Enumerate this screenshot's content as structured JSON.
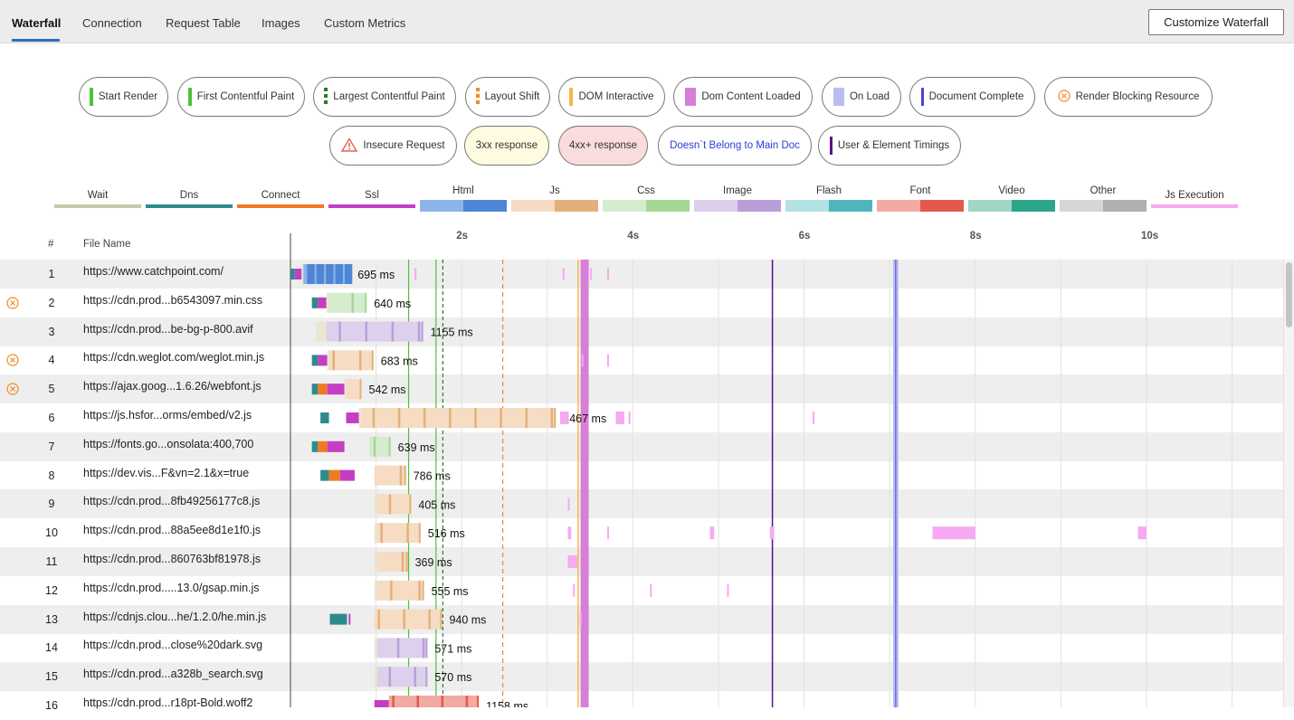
{
  "tabs": [
    {
      "label": "Waterfall",
      "active": true
    },
    {
      "label": "Connection"
    },
    {
      "label": "Request Table"
    },
    {
      "label": "Images"
    },
    {
      "label": "Custom Metrics"
    }
  ],
  "customize_button": "Customize Waterfall",
  "markers": [
    {
      "label": "Start Render",
      "color": "#4cc337",
      "style": "solid"
    },
    {
      "label": "First Contentful Paint",
      "color": "#4cc337",
      "style": "solid"
    },
    {
      "label": "Largest Contentful Paint",
      "color": "#2a7a2a",
      "style": "dashed"
    },
    {
      "label": "Layout Shift",
      "color": "#f08a24",
      "style": "dashed"
    },
    {
      "label": "DOM Interactive",
      "color": "#f2b84b",
      "style": "solid"
    },
    {
      "label": "Dom Content Loaded",
      "color": "#d77fd7",
      "style": "block"
    },
    {
      "label": "On Load",
      "color": "#b9bdf0",
      "style": "block"
    },
    {
      "label": "Document Complete",
      "color": "#4747d6",
      "style": "solid"
    },
    {
      "label": "Render Blocking Resource",
      "color": "#f08a24",
      "style": "icon"
    },
    {
      "label": "Insecure Request",
      "color": "#e0443a",
      "style": "warning"
    },
    {
      "label": "3xx response",
      "bg": "#fffbe0",
      "style": "none"
    },
    {
      "label": "4xx+ response",
      "bg": "#fbdcdc",
      "style": "none"
    },
    {
      "label": "Doesn`t Belong to Main Doc",
      "textColor": "#2a3ed6",
      "style": "none"
    },
    {
      "label": "User & Element Timings",
      "color": "#5a128a",
      "style": "solid"
    }
  ],
  "legend": [
    {
      "label": "Wait",
      "c1": "#c9c8a8"
    },
    {
      "label": "Dns",
      "c1": "#2e8b8b"
    },
    {
      "label": "Connect",
      "c1": "#f07a22"
    },
    {
      "label": "Ssl",
      "c1": "#c43ec4"
    },
    {
      "label": "Html",
      "c1": "#8db4e8",
      "c2": "#4e86d6"
    },
    {
      "label": "Js",
      "c1": "#f5dcc2",
      "c2": "#e3b07c"
    },
    {
      "label": "Css",
      "c1": "#d5ecce",
      "c2": "#a6d795"
    },
    {
      "label": "Image",
      "c1": "#ddd0ec",
      "c2": "#b99fd8"
    },
    {
      "label": "Flash",
      "c1": "#b3e2e2",
      "c2": "#4fb6bf"
    },
    {
      "label": "Font",
      "c1": "#f2aaa3",
      "c2": "#e35a4c"
    },
    {
      "label": "Video",
      "c1": "#9fd6c4",
      "c2": "#2ca58a"
    },
    {
      "label": "Other",
      "c1": "#d6d6d6",
      "c2": "#b0b0b0"
    },
    {
      "label": "Js Execution",
      "c1": "#f7a9f2"
    }
  ],
  "columns": {
    "num": "#",
    "file": "File Name"
  },
  "axis": {
    "ticks": [
      {
        "label": "2s",
        "value": 2
      },
      {
        "label": "4s",
        "value": 4
      },
      {
        "label": "6s",
        "value": 6
      },
      {
        "label": "8s",
        "value": 8
      },
      {
        "label": "10s",
        "value": 10
      }
    ]
  },
  "timing_lines": {
    "start_render": 1.38,
    "fcp": 1.7,
    "lcp": 1.78,
    "layout_shift": 2.48,
    "dom_interactive": 3.36,
    "dom_content_loaded": 3.41,
    "on_load": 7.06,
    "document_complete": 5.63
  },
  "requests": [
    {
      "num": "1",
      "url": "https://www.catchpoint.com/",
      "type": "html",
      "render_blocking": false,
      "dur": "695 ms",
      "segs": [
        [
          "dns",
          0.0,
          0.05
        ],
        [
          "ssl",
          0.05,
          0.13
        ],
        [
          "wait",
          0.13,
          0.15
        ],
        [
          "recv",
          0.15,
          0.7
        ]
      ],
      "js": [
        [
          1.45,
          1.47
        ],
        [
          3.18,
          3.2
        ],
        [
          3.5,
          3.52
        ],
        [
          3.7,
          3.72
        ]
      ]
    },
    {
      "num": "2",
      "url": "https://cdn.prod...b6543097.min.css",
      "type": "css",
      "render_blocking": true,
      "dur": "640 ms",
      "segs": [
        [
          "dns",
          0.25,
          0.32
        ],
        [
          "ssl",
          0.32,
          0.42
        ],
        [
          "wait",
          0.42,
          0.45
        ],
        [
          "recv",
          0.45,
          0.89
        ]
      ],
      "js": []
    },
    {
      "num": "3",
      "url": "https://cdn.prod...be-bg-p-800.avif",
      "type": "image",
      "render_blocking": false,
      "dur": "1155 ms",
      "segs": [
        [
          "wait",
          0.3,
          0.42
        ],
        [
          "recv",
          0.42,
          1.55
        ]
      ],
      "js": []
    },
    {
      "num": "4",
      "url": "https://cdn.weglot.com/weglot.min.js",
      "type": "js",
      "render_blocking": true,
      "dur": "683 ms",
      "segs": [
        [
          "dns",
          0.25,
          0.32
        ],
        [
          "ssl",
          0.32,
          0.43
        ],
        [
          "wait",
          0.43,
          0.45
        ],
        [
          "recv",
          0.45,
          0.97
        ]
      ],
      "js": [
        [
          3.4,
          3.42
        ],
        [
          3.7,
          3.72
        ]
      ]
    },
    {
      "num": "5",
      "url": "https://ajax.goog...1.6.26/webfont.js",
      "type": "js",
      "render_blocking": true,
      "dur": "542 ms",
      "segs": [
        [
          "dns",
          0.25,
          0.32
        ],
        [
          "connect",
          0.32,
          0.43
        ],
        [
          "ssl",
          0.43,
          0.63
        ],
        [
          "wait",
          0.63,
          0.65
        ],
        [
          "recv",
          0.65,
          0.83
        ]
      ],
      "js": []
    },
    {
      "num": "6",
      "url": "https://js.hsfor...orms/embed/v2.js",
      "type": "js",
      "render_blocking": false,
      "dur": "2467 ms",
      "segs": [
        [
          "dns",
          0.35,
          0.45
        ],
        [
          "ssl",
          0.65,
          0.8
        ],
        [
          "wait",
          0.8,
          0.82
        ],
        [
          "recv",
          0.82,
          3.1
        ]
      ],
      "js": [
        [
          3.15,
          3.25
        ],
        [
          3.8,
          3.9
        ],
        [
          3.95,
          3.97
        ],
        [
          6.1,
          6.12
        ]
      ]
    },
    {
      "num": "7",
      "url": "https://fonts.go...onsolata:400,700",
      "type": "css",
      "render_blocking": false,
      "dur": "639 ms",
      "segs": [
        [
          "dns",
          0.25,
          0.32
        ],
        [
          "connect",
          0.32,
          0.43
        ],
        [
          "ssl",
          0.43,
          0.63
        ],
        [
          "recv",
          0.92,
          1.17
        ]
      ],
      "js": []
    },
    {
      "num": "8",
      "url": "https://dev.vis...F&vn=2.1&x=true",
      "type": "js",
      "render_blocking": false,
      "dur": "786 ms",
      "segs": [
        [
          "dns",
          0.35,
          0.45
        ],
        [
          "connect",
          0.45,
          0.58
        ],
        [
          "ssl",
          0.58,
          0.75
        ],
        [
          "recv",
          0.98,
          1.35
        ]
      ],
      "js": []
    },
    {
      "num": "9",
      "url": "https://cdn.prod...8fb49256177c8.js",
      "type": "js",
      "render_blocking": false,
      "dur": "405 ms",
      "segs": [
        [
          "wait",
          0.98,
          1.01
        ],
        [
          "recv",
          1.01,
          1.41
        ]
      ],
      "js": [
        [
          3.24,
          3.26
        ]
      ]
    },
    {
      "num": "10",
      "url": "https://cdn.prod...88a5ee8d1e1f0.js",
      "type": "js",
      "render_blocking": false,
      "dur": "516 ms",
      "segs": [
        [
          "wait",
          0.98,
          1.01
        ],
        [
          "recv",
          1.01,
          1.52
        ]
      ],
      "js": [
        [
          3.24,
          3.28
        ],
        [
          3.7,
          3.72
        ],
        [
          4.9,
          4.95
        ],
        [
          5.6,
          5.65
        ],
        [
          7.5,
          8.0
        ],
        [
          9.9,
          10.0
        ]
      ]
    },
    {
      "num": "11",
      "url": "https://cdn.prod...860763bf81978.js",
      "type": "js",
      "render_blocking": false,
      "dur": "369 ms",
      "segs": [
        [
          "wait",
          0.98,
          1.01
        ],
        [
          "recv",
          1.01,
          1.37
        ]
      ],
      "js": [
        [
          3.24,
          3.35
        ]
      ]
    },
    {
      "num": "12",
      "url": "https://cdn.prod.....13.0/gsap.min.js",
      "type": "js",
      "render_blocking": false,
      "dur": "555 ms",
      "segs": [
        [
          "wait",
          0.98,
          1.01
        ],
        [
          "recv",
          1.01,
          1.56
        ]
      ],
      "js": [
        [
          3.3,
          3.32
        ],
        [
          4.2,
          4.22
        ],
        [
          5.1,
          5.12
        ]
      ]
    },
    {
      "num": "13",
      "url": "https://cdnjs.clou...he/1.2.0/he.min.js",
      "type": "js",
      "render_blocking": false,
      "dur": "940 ms",
      "segs": [
        [
          "dns",
          0.46,
          0.66
        ],
        [
          "ssl",
          0.68,
          0.7
        ],
        [
          "recv",
          0.98,
          1.77
        ]
      ],
      "js": [
        [
          3.38,
          3.4
        ]
      ]
    },
    {
      "num": "14",
      "url": "https://cdn.prod...close%20dark.svg",
      "type": "image",
      "render_blocking": false,
      "dur": "571 ms",
      "segs": [
        [
          "wait",
          0.98,
          1.01
        ],
        [
          "recv",
          1.01,
          1.6
        ]
      ],
      "js": []
    },
    {
      "num": "15",
      "url": "https://cdn.prod...a328b_search.svg",
      "type": "image",
      "render_blocking": false,
      "dur": "570 ms",
      "segs": [
        [
          "wait",
          0.98,
          1.01
        ],
        [
          "recv",
          1.01,
          1.6
        ]
      ],
      "js": []
    },
    {
      "num": "16",
      "url": "https://cdn.prod...r18pt-Bold.woff2",
      "type": "font",
      "render_blocking": false,
      "dur": "1158 ms",
      "segs": [
        [
          "ssl",
          0.98,
          1.15
        ],
        [
          "recv",
          1.15,
          2.2
        ]
      ],
      "js": []
    }
  ]
}
